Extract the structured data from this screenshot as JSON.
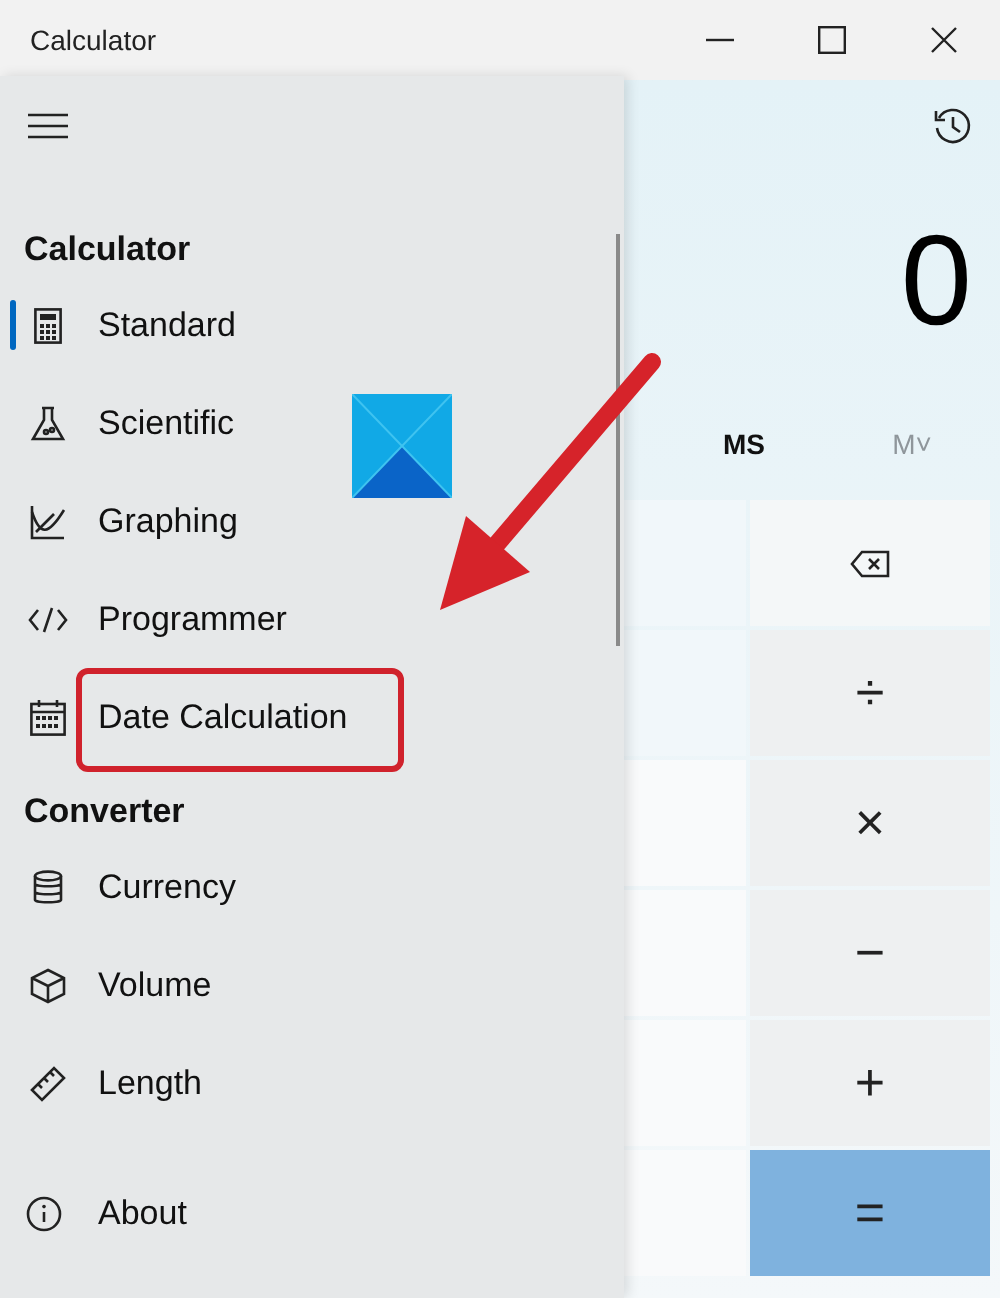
{
  "window": {
    "title": "Calculator"
  },
  "display": {
    "value": "0"
  },
  "memory": [
    {
      "label": "MS",
      "disabled": false
    },
    {
      "label": "M˅",
      "disabled": true
    }
  ],
  "keys": [
    {
      "kind": "backspace"
    },
    {
      "kind": "operator",
      "label": "÷"
    },
    {
      "kind": "operator",
      "label": "×"
    },
    {
      "kind": "operator",
      "label": "−"
    },
    {
      "kind": "operator",
      "label": "+"
    },
    {
      "kind": "equals",
      "label": "="
    }
  ],
  "nav": {
    "sections": [
      {
        "heading": "Calculator",
        "items": [
          {
            "label": "Standard",
            "selected": true
          },
          {
            "label": "Scientific",
            "selected": false
          },
          {
            "label": "Graphing",
            "selected": false
          },
          {
            "label": "Programmer",
            "selected": false
          },
          {
            "label": "Date Calculation",
            "selected": false,
            "highlighted": true
          }
        ]
      },
      {
        "heading": "Converter",
        "items": [
          {
            "label": "Currency",
            "selected": false
          },
          {
            "label": "Volume",
            "selected": false
          },
          {
            "label": "Length",
            "selected": false
          }
        ]
      }
    ],
    "footer": {
      "label": "About"
    }
  }
}
